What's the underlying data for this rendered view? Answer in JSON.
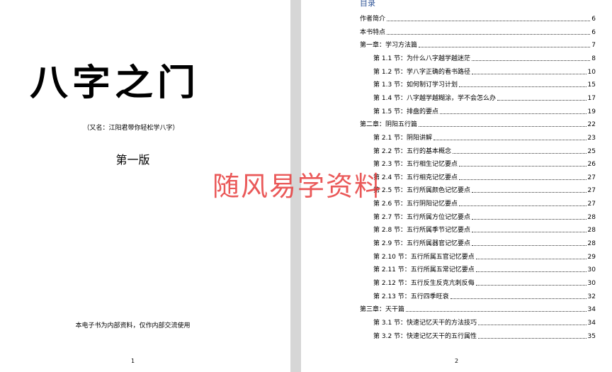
{
  "page1": {
    "title": "八字之门",
    "subtitle": "（又名：江阳君带你轻松学八字）",
    "edition": "第一版",
    "notice": "本电子书为内部资料，仅作内部交流使用",
    "page_number": "1"
  },
  "page2": {
    "heading": "目录",
    "page_number": "2",
    "toc": [
      {
        "label": "作者简介",
        "page": "6",
        "level": "chapter"
      },
      {
        "label": "本书特点",
        "page": "6",
        "level": "chapter"
      },
      {
        "label": "第一章：学习方法篇",
        "page": "7",
        "level": "chapter"
      },
      {
        "label": "第 1.1 节：为什么八字越学越迷茫",
        "page": "8",
        "level": "section"
      },
      {
        "label": "第 1.2 节：学八字正确的看书路径",
        "page": "10",
        "level": "section"
      },
      {
        "label": "第 1.3 节：如何制订学习计划",
        "page": "15",
        "level": "section"
      },
      {
        "label": "第 1.4 节：八字越学越糊涂，学不会怎么办",
        "page": "17",
        "level": "section"
      },
      {
        "label": "第 1.5 节：排盘的要点",
        "page": "19",
        "level": "section"
      },
      {
        "label": "第二章：阴阳五行篇",
        "page": "22",
        "level": "chapter"
      },
      {
        "label": "第 2.1 节：阴阳讲解",
        "page": "23",
        "level": "section"
      },
      {
        "label": "第 2.2 节：五行的基本概念",
        "page": "25",
        "level": "section"
      },
      {
        "label": "第 2.3 节：五行相生记忆要点",
        "page": "26",
        "level": "section"
      },
      {
        "label": "第 2.4 节：五行相克记忆要点",
        "page": "27",
        "level": "section"
      },
      {
        "label": "第 2.5 节：五行所属颜色记忆要点",
        "page": "27",
        "level": "section"
      },
      {
        "label": "第 2.6 节：五行阴阳记忆要点",
        "page": "27",
        "level": "section"
      },
      {
        "label": "第 2.7 节：五行所属方位记忆要点",
        "page": "28",
        "level": "section"
      },
      {
        "label": "第 2.8 节：五行所属季节记忆要点",
        "page": "28",
        "level": "section"
      },
      {
        "label": "第 2.9 节：五行所属器官记忆要点",
        "page": "28",
        "level": "section"
      },
      {
        "label": "第 2.10 节：五行所属五官记忆要点",
        "page": "29",
        "level": "section"
      },
      {
        "label": "第 2.11 节：五行所属五常记忆要点",
        "page": "30",
        "level": "section"
      },
      {
        "label": "第 2.12 节：五行反生反克亢刺反侮",
        "page": "30",
        "level": "section"
      },
      {
        "label": "第 2.13 节：五行四季旺衰",
        "page": "32",
        "level": "section"
      },
      {
        "label": "第三章：天干篇",
        "page": "34",
        "level": "chapter"
      },
      {
        "label": "第 3.1 节：快速记忆天干的方法技巧",
        "page": "34",
        "level": "section"
      },
      {
        "label": "第 3.2 节：快速记忆天干的五行属性",
        "page": "35",
        "level": "section"
      }
    ]
  },
  "watermark": "随风易学资料",
  "colors": {
    "background": "#d6d6d6",
    "page": "#ffffff",
    "heading": "#2f5597",
    "watermark": "#e63c3c"
  }
}
